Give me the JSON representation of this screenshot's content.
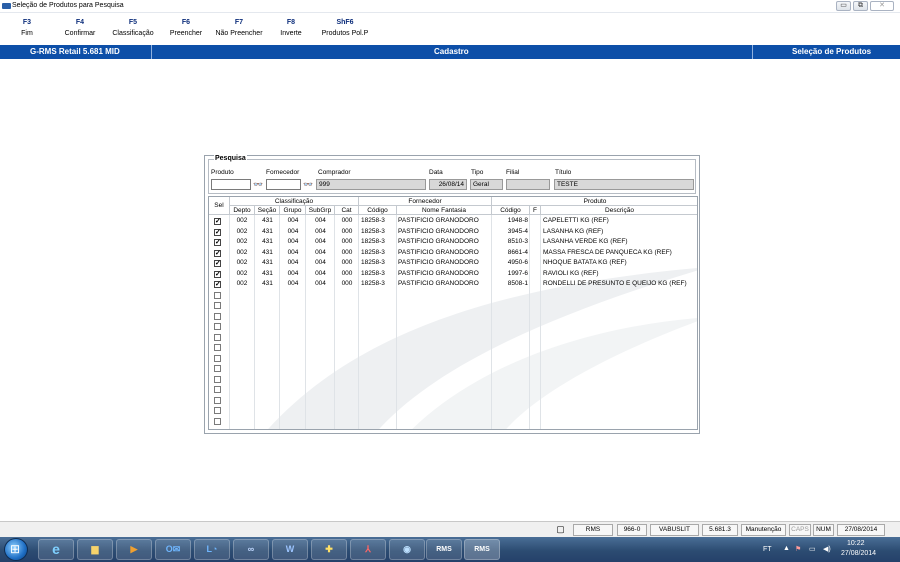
{
  "window": {
    "title": "Seleção de Produtos para Pesquisa"
  },
  "window_buttons": [
    "▭",
    "⧉",
    "✕"
  ],
  "fkeys": [
    {
      "key": "F3",
      "label": "Fim"
    },
    {
      "key": "F4",
      "label": "Confirmar"
    },
    {
      "key": "F5",
      "label": "Classificação"
    },
    {
      "key": "F6",
      "label": "Preencher"
    },
    {
      "key": "F7",
      "label": "Não Preencher"
    },
    {
      "key": "F8",
      "label": "Inverte"
    },
    {
      "key": "ShF6",
      "label": "Produtos Pol.P"
    }
  ],
  "header": {
    "app": "G-RMS Retail 5.681 MID",
    "module": "Cadastro",
    "screen": "Seleção de Produtos"
  },
  "search": {
    "legend": "Pesquisa",
    "labels": {
      "produto": "Produto",
      "fornecedor": "Fornecedor",
      "comprador": "Comprador",
      "data": "Data",
      "tipo": "Tipo",
      "filial": "Filial",
      "titulo": "Título"
    },
    "values": {
      "produto": "",
      "fornecedor": "",
      "comprador": "999",
      "data": "26/08/14",
      "tipo": "Geral",
      "filial": "",
      "titulo": "TESTE"
    }
  },
  "grid": {
    "group_headers": {
      "classificacao": "Classificação",
      "fornecedor": "Fornecedor",
      "produto": "Produto"
    },
    "columns": [
      "Sel",
      "Depto",
      "Seção",
      "Grupo",
      "SubGrp",
      "Cat",
      "Código",
      "Nome Fantasia",
      "Código",
      "F",
      "Descrição"
    ],
    "rows": [
      {
        "sel": true,
        "depto": "002",
        "secao": "431",
        "grupo": "004",
        "subgrp": "004",
        "cat": "000",
        "forn_codigo": "18258-3",
        "nome_fantasia": "PASTIFICIO GRANODORO",
        "prod_codigo": "1948-8",
        "f": "",
        "descricao": "CAPELETTI KG (REF)"
      },
      {
        "sel": true,
        "depto": "002",
        "secao": "431",
        "grupo": "004",
        "subgrp": "004",
        "cat": "000",
        "forn_codigo": "18258-3",
        "nome_fantasia": "PASTIFICIO GRANODORO",
        "prod_codigo": "3945-4",
        "f": "",
        "descricao": "LASANHA KG (REF)"
      },
      {
        "sel": true,
        "depto": "002",
        "secao": "431",
        "grupo": "004",
        "subgrp": "004",
        "cat": "000",
        "forn_codigo": "18258-3",
        "nome_fantasia": "PASTIFICIO GRANODORO",
        "prod_codigo": "8510-3",
        "f": "",
        "descricao": "LASANHA VERDE KG (REF)"
      },
      {
        "sel": true,
        "depto": "002",
        "secao": "431",
        "grupo": "004",
        "subgrp": "004",
        "cat": "000",
        "forn_codigo": "18258-3",
        "nome_fantasia": "PASTIFICIO GRANODORO",
        "prod_codigo": "8661-4",
        "f": "",
        "descricao": "MASSA FRESCA DE PANQUECA KG (REF)"
      },
      {
        "sel": true,
        "depto": "002",
        "secao": "431",
        "grupo": "004",
        "subgrp": "004",
        "cat": "000",
        "forn_codigo": "18258-3",
        "nome_fantasia": "PASTIFICIO GRANODORO",
        "prod_codigo": "4950-6",
        "f": "",
        "descricao": "NHOQUE BATATA KG (REF)"
      },
      {
        "sel": true,
        "depto": "002",
        "secao": "431",
        "grupo": "004",
        "subgrp": "004",
        "cat": "000",
        "forn_codigo": "18258-3",
        "nome_fantasia": "PASTIFICIO GRANODORO",
        "prod_codigo": "1997-6",
        "f": "",
        "descricao": "RAVIOLI KG (REF)"
      },
      {
        "sel": true,
        "depto": "002",
        "secao": "431",
        "grupo": "004",
        "subgrp": "004",
        "cat": "000",
        "forn_codigo": "18258-3",
        "nome_fantasia": "PASTIFICIO GRANODORO",
        "prod_codigo": "8508-1",
        "f": "",
        "descricao": "RONDELLI DE PRESUNTO E QUEIJO KG (REF)"
      }
    ],
    "empty_rows": 13
  },
  "statusbar": {
    "cells": [
      "RMS",
      "966-0",
      "VABUSLIT",
      "5.681.3",
      "Manutenção",
      "CAPS",
      "NUM",
      "27/08/2014"
    ],
    "dim_cells": [
      "CAPS"
    ]
  },
  "taskbar": {
    "apps": [
      "IE",
      "Explorer",
      "Media",
      "Outlook",
      "Lync",
      "Loop",
      "Word",
      "Install",
      "PDF",
      "Globe",
      "RMS",
      "RMS"
    ],
    "tray_lang": "FT",
    "clock_time": "10:22",
    "clock_date": "27/08/2014"
  }
}
